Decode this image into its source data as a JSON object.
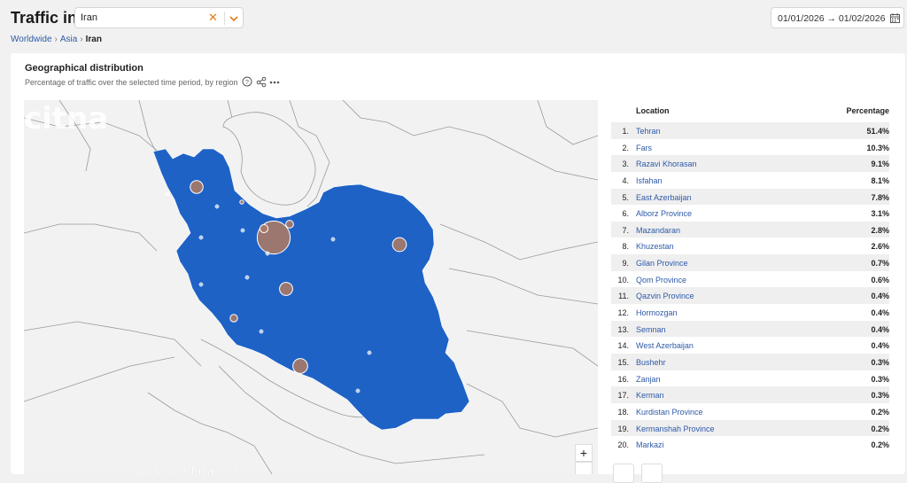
{
  "header": {
    "title": "Traffic in",
    "country_value": "Iran",
    "date_range": "01/01/2026 → 01/02/2026"
  },
  "breadcrumb": {
    "items": [
      "Worldwide",
      "Asia"
    ],
    "current": "Iran"
  },
  "panel": {
    "title": "Geographical distribution",
    "subtitle": "Percentage of traffic over the selected time period, by region"
  },
  "map": {
    "watermark": "www.citna.ir",
    "zoom_in": "+",
    "colors": {
      "country_fill": "#1e62c6",
      "bubble": "#a87a66",
      "background": "#f2f2f2",
      "land": "#ffffff"
    }
  },
  "table": {
    "col_location": "Location",
    "col_percentage": "Percentage",
    "rows": [
      {
        "rank": "1.",
        "location": "Tehran",
        "percentage": "51.4%"
      },
      {
        "rank": "2.",
        "location": "Fars",
        "percentage": "10.3%"
      },
      {
        "rank": "3.",
        "location": "Razavi Khorasan",
        "percentage": "9.1%"
      },
      {
        "rank": "4.",
        "location": "Isfahan",
        "percentage": "8.1%"
      },
      {
        "rank": "5.",
        "location": "East Azerbaijan",
        "percentage": "7.8%"
      },
      {
        "rank": "6.",
        "location": "Alborz Province",
        "percentage": "3.1%"
      },
      {
        "rank": "7.",
        "location": "Mazandaran",
        "percentage": "2.8%"
      },
      {
        "rank": "8.",
        "location": "Khuzestan",
        "percentage": "2.6%"
      },
      {
        "rank": "9.",
        "location": "Gilan Province",
        "percentage": "0.7%"
      },
      {
        "rank": "10.",
        "location": "Qom Province",
        "percentage": "0.6%"
      },
      {
        "rank": "11.",
        "location": "Qazvin Province",
        "percentage": "0.4%"
      },
      {
        "rank": "12.",
        "location": "Hormozgan",
        "percentage": "0.4%"
      },
      {
        "rank": "13.",
        "location": "Semnan",
        "percentage": "0.4%"
      },
      {
        "rank": "14.",
        "location": "West Azerbaijan",
        "percentage": "0.4%"
      },
      {
        "rank": "15.",
        "location": "Bushehr",
        "percentage": "0.3%"
      },
      {
        "rank": "16.",
        "location": "Zanjan",
        "percentage": "0.3%"
      },
      {
        "rank": "17.",
        "location": "Kerman",
        "percentage": "0.3%"
      },
      {
        "rank": "18.",
        "location": "Kurdistan Province",
        "percentage": "0.2%"
      },
      {
        "rank": "19.",
        "location": "Kermanshah Province",
        "percentage": "0.2%"
      },
      {
        "rank": "20.",
        "location": "Markazi",
        "percentage": "0.2%"
      }
    ]
  }
}
